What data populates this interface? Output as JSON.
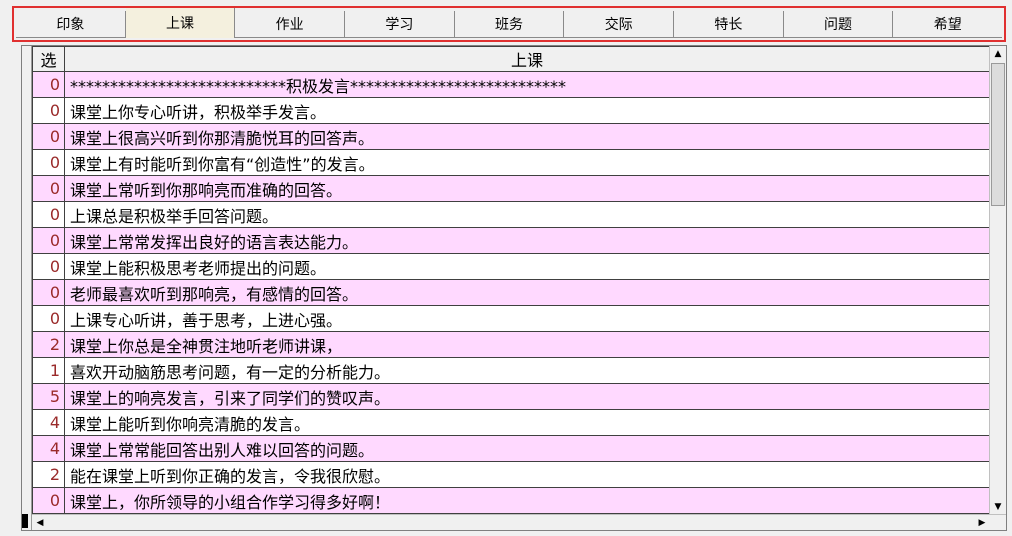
{
  "tabs": [
    {
      "label": "印象",
      "active": false
    },
    {
      "label": "上课",
      "active": true
    },
    {
      "label": "作业",
      "active": false
    },
    {
      "label": "学习",
      "active": false
    },
    {
      "label": "班务",
      "active": false
    },
    {
      "label": "交际",
      "active": false
    },
    {
      "label": "特长",
      "active": false
    },
    {
      "label": "问题",
      "active": false
    },
    {
      "label": "希望",
      "active": false
    }
  ],
  "grid": {
    "columns": [
      "选",
      "上课"
    ],
    "rows": [
      {
        "sel": "0",
        "text": "***************************积极发言***************************"
      },
      {
        "sel": "0",
        "text": "课堂上你专心听讲，积极举手发言。"
      },
      {
        "sel": "0",
        "text": "课堂上很高兴听到你那清脆悦耳的回答声。"
      },
      {
        "sel": "0",
        "text": "课堂上有时能听到你富有“创造性”的发言。"
      },
      {
        "sel": "0",
        "text": "课堂上常听到你那响亮而准确的回答。"
      },
      {
        "sel": "0",
        "text": "上课总是积极举手回答问题。"
      },
      {
        "sel": "0",
        "text": "课堂上常常发挥出良好的语言表达能力。"
      },
      {
        "sel": "0",
        "text": "课堂上能积极思考老师提出的问题。"
      },
      {
        "sel": "0",
        "text": "老师最喜欢听到那响亮，有感情的回答。"
      },
      {
        "sel": "0",
        "text": "上课专心听讲，善于思考，上进心强。"
      },
      {
        "sel": "2",
        "text": "课堂上你总是全神贯注地听老师讲课，"
      },
      {
        "sel": "1",
        "text": "喜欢开动脑筋思考问题，有一定的分析能力。"
      },
      {
        "sel": "5",
        "text": "课堂上的响亮发言，引来了同学们的赞叹声。"
      },
      {
        "sel": "4",
        "text": "课堂上能听到你响亮清脆的发言。"
      },
      {
        "sel": "4",
        "text": "课堂上常常能回答出别人难以回答的问题。"
      },
      {
        "sel": "2",
        "text": "能在课堂上听到你正确的发言，令我很欣慰。"
      },
      {
        "sel": "0",
        "text": "课堂上，你所领导的小组合作学习得多好啊！"
      }
    ]
  },
  "scroll": {
    "up_icon": "▲",
    "down_icon": "▼",
    "left_icon": "◀",
    "right_icon": "▶"
  }
}
